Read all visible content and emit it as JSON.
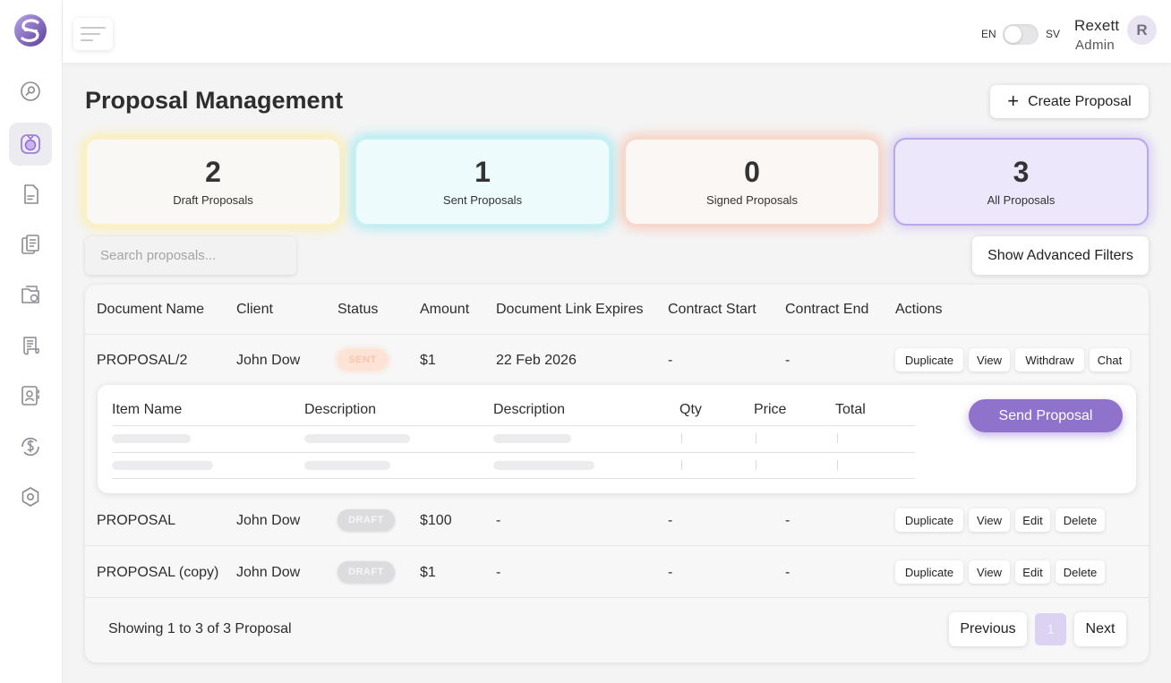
{
  "topbar": {
    "lang_left": "EN",
    "lang_right": "SV",
    "user_name": "Rexett",
    "user_role": "Admin",
    "avatar_initial": "R"
  },
  "sidebar": {
    "items": [
      {
        "icon": "search-dial-icon",
        "active": false
      },
      {
        "icon": "proposals-icon",
        "active": true
      },
      {
        "icon": "document-icon",
        "active": false
      },
      {
        "icon": "clipboard-icon",
        "active": false
      },
      {
        "icon": "folder-icon",
        "active": false
      },
      {
        "icon": "scroll-icon",
        "active": false
      },
      {
        "icon": "contact-card-icon",
        "active": false
      },
      {
        "icon": "currency-cycle-icon",
        "active": false
      },
      {
        "icon": "settings-icon",
        "active": false
      }
    ]
  },
  "page": {
    "title": "Proposal Management",
    "create_button": "Create Proposal",
    "search_placeholder": "Search proposals...",
    "advanced_filters": "Show Advanced Filters"
  },
  "stats": [
    {
      "value": "2",
      "label": "Draft Proposals"
    },
    {
      "value": "1",
      "label": "Sent Proposals"
    },
    {
      "value": "0",
      "label": "Signed Proposals"
    },
    {
      "value": "3",
      "label": "All Proposals"
    }
  ],
  "table": {
    "headers": [
      "Document Name",
      "Client",
      "Status",
      "Amount",
      "Document Link Expires",
      "Contract Start",
      "Contract End",
      "Actions"
    ],
    "rows": [
      {
        "name": "PROPOSAL/2",
        "client": "John Dow",
        "status": "SENT",
        "amount": "$1",
        "expires": "22 Feb 2026",
        "start": "-",
        "end": "-",
        "actions": [
          "Duplicate",
          "View",
          "Withdraw",
          "Chat"
        ]
      },
      {
        "name": "PROPOSAL",
        "client": "John Dow",
        "status": "DRAFT",
        "amount": "$100",
        "expires": "-",
        "start": "-",
        "end": "-",
        "actions": [
          "Duplicate",
          "View",
          "Edit",
          "Delete"
        ]
      },
      {
        "name": "PROPOSAL (copy)",
        "client": "John Dow",
        "status": "DRAFT",
        "amount": "$1",
        "expires": "-",
        "start": "-",
        "end": "-",
        "actions": [
          "Duplicate",
          "View",
          "Edit",
          "Delete"
        ]
      }
    ]
  },
  "expanded": {
    "headers": [
      "Item Name",
      "Description",
      "Description",
      "Qty",
      "Price",
      "Total"
    ],
    "send_button": "Send Proposal"
  },
  "pagination": {
    "summary": "Showing 1 to 3 of 3 Proposal",
    "previous": "Previous",
    "page": "1",
    "next": "Next"
  },
  "colors": {
    "accent": "#8e72cb",
    "sent_badge": "#fde3d6",
    "draft_badge": "#dcdcde"
  }
}
